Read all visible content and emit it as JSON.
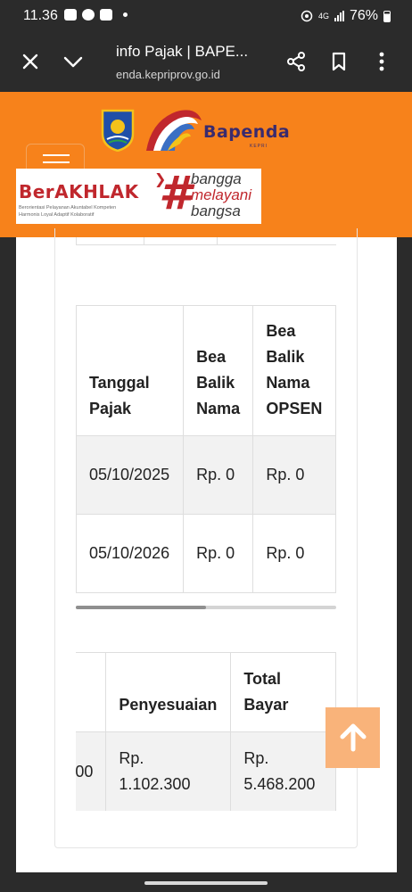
{
  "status_bar": {
    "time": "11.36",
    "network": "4G",
    "battery": "76%"
  },
  "browser": {
    "page_title": "info Pajak | BAPE...",
    "url": "enda.kepriprov.go.id"
  },
  "header": {
    "brand": "Bapenda",
    "brand_sub": "KEPRI",
    "akhlak_word": "BerAKHLAK",
    "akhlak_tagline_1": "Berorientasi Pelayanan Akuntabel Kompeten",
    "akhlak_tagline_2": "Harmonis Loyal Adaptif Kolaboratif",
    "slogan_line_1": "bangga",
    "slogan_line_2": "melayani",
    "slogan_line_3": "bangsa",
    "hash": "#"
  },
  "table_one": {
    "headers": [
      "Tanggal Pajak",
      "Bea Balik Nama",
      "Bea Balik Nama OPSEN"
    ],
    "rows": [
      [
        "05/10/2025",
        "Rp. 0",
        "Rp. 0"
      ],
      [
        "05/10/2026",
        "Rp. 0",
        "Rp. 0"
      ]
    ],
    "scroll_position": 0.5
  },
  "table_two": {
    "headers": [
      "",
      "Penyesuaian",
      "Total Bayar"
    ],
    "rows": [
      [
        "00",
        "Rp. 1.102.300",
        "Rp. 5.468.200"
      ]
    ]
  },
  "colors": {
    "header_orange": "#f7821b",
    "brand_red": "#c0272d",
    "brand_purple": "#3a2b6e",
    "scroll_top_button": "#f9b37a"
  }
}
